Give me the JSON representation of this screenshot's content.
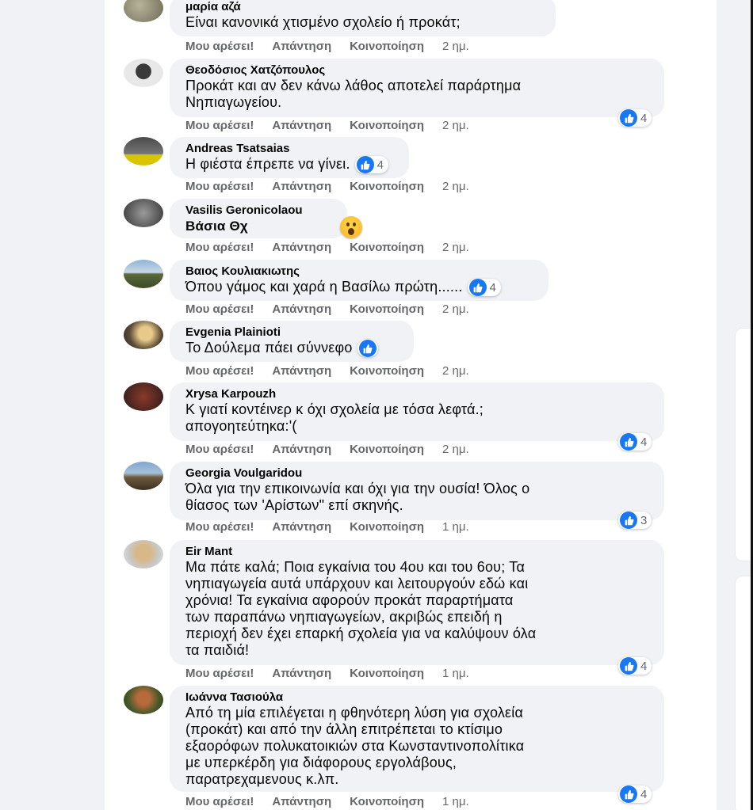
{
  "actions": {
    "like": "Μου αρέσει!",
    "reply": "Απάντηση",
    "share": "Κοινοποίηση"
  },
  "comments": [
    {
      "name": "μαρία αζά",
      "lines": [
        "Είναι κανονικά χτισμένο σχολείο ή προκάτ;"
      ],
      "time": "2 ημ.",
      "reactions": ""
    },
    {
      "name": "Θεοδόσιος Χατζόπουλος",
      "lines": [
        "Προκάτ και αν δεν κάνω λάθος αποτελεί παράρτημα",
        "Νηπιαγωγείου."
      ],
      "time": "2 ημ.",
      "reactions": "4"
    },
    {
      "name": "Andreas Tsatsaias",
      "lines": [
        "Η φιέστα έπρεπε να γίνει."
      ],
      "time": "2 ημ.",
      "reactions": "4"
    },
    {
      "name": "Vasilis Geronicolaou",
      "lines": [
        "Βάσια Θχ"
      ],
      "time": "2 ημ.",
      "reactions": ""
    },
    {
      "name": "Βαιος Κουλιακιωτης",
      "lines": [
        "Όπου γάμος και χαρά η Βασίλω πρώτη......"
      ],
      "time": "2 ημ.",
      "reactions": "4"
    },
    {
      "name": "Evgenia Plainioti",
      "lines": [
        "Το Δούλεμα πάει σύννεφο"
      ],
      "time": "2 ημ.",
      "reactions": ""
    },
    {
      "name": "Xrysa Karpouzh",
      "lines": [
        "Κ γιατί κοντέινερ κ όχι σχολεία με τόσα λεφτά.;",
        "απογοητεύτηκα:'("
      ],
      "time": "2 ημ.",
      "reactions": "4"
    },
    {
      "name": "Georgia Voulgaridou",
      "lines": [
        "Όλα για την επικοινωνία και όχι για την ουσία! Όλος ο",
        "θίασος των 'Αρίστων\" επί σκηνής."
      ],
      "time": "1 ημ.",
      "reactions": "3"
    },
    {
      "name": "Eir Mant",
      "lines": [
        "Μα πάτε καλά; Ποια εγκαίνια του 4ου και του 6ου; Τα",
        "νηπιαγωγεία αυτά υπάρχουν και λειτουργούν εδώ και",
        "χρόνια! Τα εγκαίνια αφορούν προκάτ παραρτήματα",
        "των παραπάνω νηπιαγωγείων, ακριβώς επειδή η",
        "περιοχή δεν έχει επαρκή σχολεία για να καλύψουν όλα",
        "τα παιδιά!"
      ],
      "time": "1 ημ.",
      "reactions": "4"
    },
    {
      "name": "Ιωάννα Τασιούλα",
      "lines": [
        "Από τη μία επιλέγεται η φθηνότερη λύση για σχολεία",
        "(προκάτ) και από την άλλη επιτρέπεται το κτίσιμο",
        "εξαορόφων πολυκατοικιών στα Κωνσταντινοπολίτικα",
        "με υπερκέρδη για διάφορους εργολάβους,",
        "παρατρεχαμενους κ.λπ."
      ],
      "time": "1 ημ.",
      "reactions": "4"
    }
  ],
  "colors": {
    "like_blue": "#1877f2",
    "bubble": "#f0f2f5",
    "meta": "#65676b"
  },
  "icons": [
    "like-icon",
    "wow-icon"
  ]
}
